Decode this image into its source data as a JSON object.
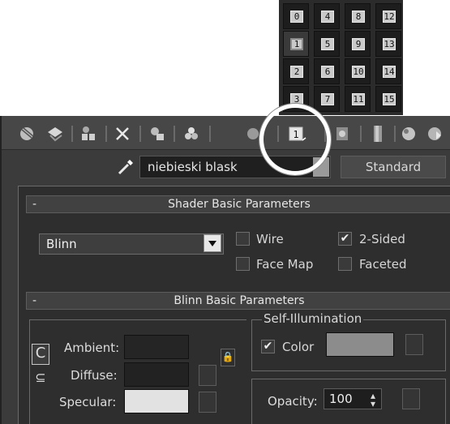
{
  "sample_slots": [
    [
      "0",
      "4",
      "8",
      "12"
    ],
    [
      "1",
      "5",
      "9",
      "13"
    ],
    [
      "2",
      "6",
      "10",
      "14"
    ],
    [
      "3",
      "7",
      "11",
      "15"
    ]
  ],
  "active_slot": "1",
  "active_slot_button_label": "1",
  "material": {
    "name": "niebieski blask",
    "type_button": "Standard"
  },
  "shader_basic": {
    "title": "Shader Basic Parameters",
    "collapse_symbol": "-",
    "shader": "Blinn",
    "wire": {
      "label": "Wire",
      "checked": false
    },
    "two_sided": {
      "label": "2-Sided",
      "checked": true
    },
    "face_map": {
      "label": "Face Map",
      "checked": false
    },
    "faceted": {
      "label": "Faceted",
      "checked": false
    }
  },
  "blinn_basic": {
    "title": "Blinn Basic Parameters",
    "collapse_symbol": "-",
    "ambient_label": "Ambient:",
    "diffuse_label": "Diffuse:",
    "specular_label": "Specular:",
    "self_illum_title": "Self-Illumination",
    "self_illum_color": {
      "label": "Color",
      "checked": true
    },
    "opacity_label": "Opacity:",
    "opacity_value": "100",
    "lock_button_symbol": "C",
    "lock2_symbol": "⊆"
  },
  "colors": {
    "ambient": "#252525",
    "diffuse": "#222222",
    "specular": "#e2e2e2",
    "self_illum": "#8c8c8c"
  },
  "icons": [
    "get-material-icon",
    "put-to-scene-icon",
    "assign-to-selection-icon",
    "reset-map-icon",
    "make-unique-icon",
    "put-to-library-icon",
    "material-id-channel-icon",
    "show-map-in-viewport-icon",
    "show-end-result-icon",
    "go-to-parent-icon",
    "go-forward-to-sibling-icon",
    "eyedropper-icon"
  ]
}
